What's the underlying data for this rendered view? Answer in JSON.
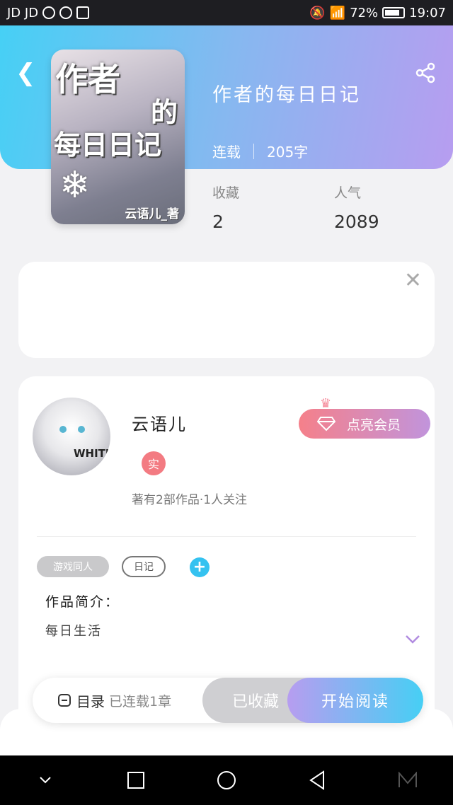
{
  "status_bar": {
    "carrier": "JD JD",
    "battery": "72%",
    "time": "19:07"
  },
  "header": {
    "book_title": "作者的每日日记",
    "status": "连载",
    "word_count": "205字"
  },
  "cover": {
    "line1": "作者",
    "line2": "的",
    "line3": "每日日记",
    "author_mark": "云语儿_著"
  },
  "stats": {
    "favorites_label": "收藏",
    "favorites_value": "2",
    "popularity_label": "人气",
    "popularity_value": "2089"
  },
  "author": {
    "name": "云语儿",
    "verified_badge": "实",
    "works_info": "著有2部作品·1人关注",
    "vip_button": "点亮会员",
    "avatar_text": "WHITE"
  },
  "tags": [
    "游戏同人",
    "日记"
  ],
  "intro": {
    "heading": "作品简介：",
    "text": "每日生活"
  },
  "action_bar": {
    "catalog_label": "目录",
    "chapters_label": "已连载1章",
    "favorited_label": "已收藏",
    "read_label": "开始阅读"
  },
  "colors": {
    "gradient_start": "#46d0f5",
    "gradient_end": "#b79df0",
    "vip_start": "#f5808a",
    "accent_plus": "#35c2f0"
  }
}
